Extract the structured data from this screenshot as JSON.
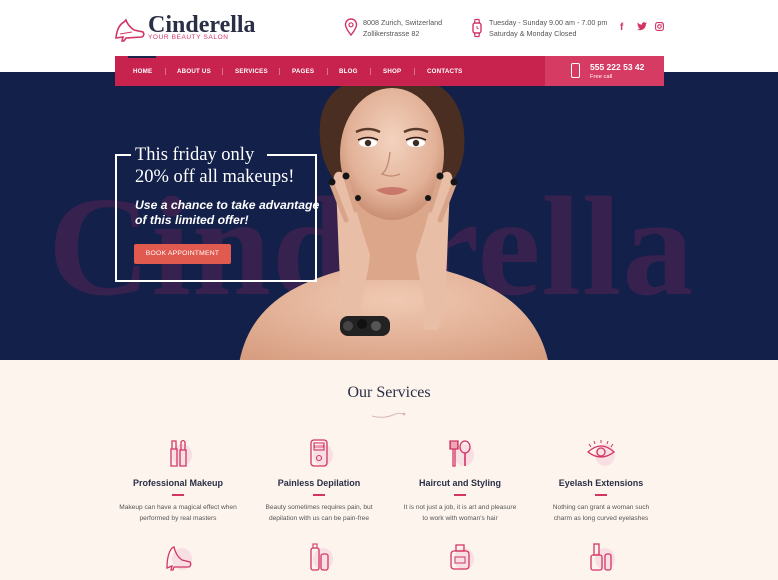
{
  "brand": {
    "name": "Cinderella",
    "tagline": "YOUR BEAUTY SALON"
  },
  "header": {
    "address_line1": "8008 Zurich, Switzerland",
    "address_line2": "Zollikerstrasse 82",
    "hours_line1": "Tuesday - Sunday 9.00 am - 7.00 pm",
    "hours_line2": "Saturday & Monday Closed",
    "social": {
      "facebook": "f",
      "twitter": "t",
      "instagram": "◎"
    }
  },
  "nav": {
    "items": [
      "HOME",
      "ABOUT US",
      "SERVICES",
      "PAGES",
      "BLOG",
      "SHOP",
      "CONTACTS"
    ],
    "active": "HOME",
    "phone": "555 222 53 42",
    "phone_label": "Free call"
  },
  "hero": {
    "watermark": "Cinderella",
    "title_line1": "This friday only",
    "title_line2": "20% off all makeups!",
    "offer_line1": "Use a chance to take advantage",
    "offer_line2": "of this limited offer!",
    "button": "BOOK APPOINTMENT"
  },
  "services": {
    "title": "Our Services",
    "items": [
      {
        "name": "Professional Makeup",
        "desc1": "Makeup can have a magical effect when",
        "desc2": "performed by real masters",
        "icon": "makeup-brush-icon"
      },
      {
        "name": "Painless Depilation",
        "desc1": "Beauty sometimes requires pain, but",
        "desc2": "depilation with us can be pain-free",
        "icon": "epilator-icon"
      },
      {
        "name": "Haircut and Styling",
        "desc1": "It is not just a job, it is art and pleasure",
        "desc2": "to work with woman's hair",
        "icon": "comb-icon"
      },
      {
        "name": "Eyelash Extensions",
        "desc1": "Nothing can grant a woman such",
        "desc2": "charm as  long curved eyelashes",
        "icon": "eye-icon"
      }
    ],
    "row2_icons": [
      "high-heel-icon",
      "cosmetic-tubes-icon",
      "perfume-jar-icon",
      "nail-polish-icon"
    ]
  },
  "colors": {
    "accent": "#c8224f",
    "navy": "#13204a",
    "button": "#e05a4f",
    "cream": "#fdf4ee"
  }
}
